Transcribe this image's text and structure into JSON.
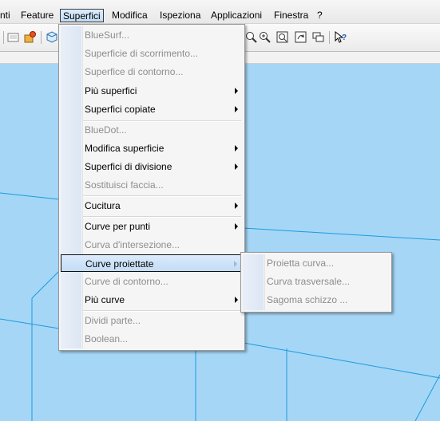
{
  "menubar": {
    "items": [
      "nti",
      "Feature",
      "Superfici",
      "Modifica",
      "Ispeziona",
      "Applicazioni",
      "Finestra",
      "?"
    ],
    "active_index": 2
  },
  "superfici_menu": {
    "items": [
      {
        "label": "BlueSurf...",
        "enabled": false,
        "submenu": false
      },
      {
        "label": "Superficie di scorrimento...",
        "enabled": false,
        "submenu": false
      },
      {
        "label": "Superfice di contorno...",
        "enabled": false,
        "submenu": false
      },
      {
        "label": "Più superfici",
        "enabled": true,
        "submenu": true
      },
      {
        "label": "Superfici copiate",
        "enabled": true,
        "submenu": true
      },
      {
        "label": "BlueDot...",
        "enabled": false,
        "submenu": false
      },
      {
        "label": "Modifica superficie",
        "enabled": true,
        "submenu": true
      },
      {
        "label": "Superfici di divisione",
        "enabled": true,
        "submenu": true
      },
      {
        "label": "Sostituisci faccia...",
        "enabled": false,
        "submenu": false
      },
      {
        "label": "Cucitura",
        "enabled": true,
        "submenu": true
      },
      {
        "label": "Curve per punti",
        "enabled": true,
        "submenu": true
      },
      {
        "label": "Curva d'intersezione...",
        "enabled": false,
        "submenu": false
      },
      {
        "label": "Curve proiettate",
        "enabled": true,
        "submenu": true,
        "highlighted": true
      },
      {
        "label": "Curve di contorno...",
        "enabled": false,
        "submenu": false
      },
      {
        "label": "Più curve",
        "enabled": true,
        "submenu": true
      },
      {
        "label": "Dividi parte...",
        "enabled": false,
        "submenu": false
      },
      {
        "label": "Boolean...",
        "enabled": false,
        "submenu": false
      }
    ]
  },
  "submenu_curve_proiettate": {
    "items": [
      {
        "label": "Proietta curva...",
        "enabled": false
      },
      {
        "label": "Curva trasversale...",
        "enabled": false
      },
      {
        "label": "Sagoma schizzo ...",
        "enabled": false
      }
    ]
  },
  "colors": {
    "canvas_bg": "#a6d6f6",
    "canvas_lines": "#1a9be0",
    "highlight": "#c3dcf6",
    "disabled_text": "#8d8d8d"
  },
  "icons": [
    "save-icon",
    "settings-icon",
    "box-icon",
    "zoom-fit-icon",
    "zoom-icon",
    "zoom-box-icon",
    "rotate-view-icon",
    "window-icon",
    "whats-this-icon"
  ]
}
